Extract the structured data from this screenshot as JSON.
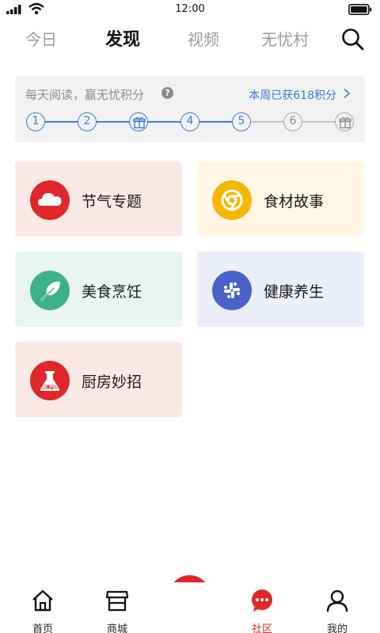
{
  "status_bar": {
    "time": "12:00"
  },
  "top_tabs": {
    "tabs": [
      {
        "label": "今日"
      },
      {
        "label": "发现"
      },
      {
        "label": "视频"
      },
      {
        "label": "无忧村"
      }
    ],
    "active_index": 1
  },
  "reading": {
    "title": "每天阅读，赢无忧积分",
    "help": "?",
    "week_points": "本周已获618积分",
    "steps": [
      "1",
      "2",
      "gift",
      "4",
      "5",
      "6",
      "gift"
    ],
    "completed_steps": 5
  },
  "categories": [
    {
      "label": "节气专题",
      "icon": "cloud-icon",
      "bg": "#fbe9e7",
      "icon_bg": "#e0282a"
    },
    {
      "label": "食材故事",
      "icon": "chrome-icon",
      "bg": "#fff6e4",
      "icon_bg": "#f5b800"
    },
    {
      "label": "美食烹饪",
      "icon": "feather-icon",
      "bg": "#e8f5f0",
      "icon_bg": "#3db389"
    },
    {
      "label": "健康养生",
      "icon": "slack-icon",
      "bg": "#eceefa",
      "icon_bg": "#4a63c8"
    },
    {
      "label": "厨房妙招",
      "icon": "flask-icon",
      "bg": "#fbe9e7",
      "icon_bg": "#e0282a"
    }
  ],
  "bottom_nav": {
    "items": [
      {
        "label": "首页",
        "icon": "home-icon"
      },
      {
        "label": "商城",
        "icon": "store-icon"
      },
      {
        "label": "社区",
        "icon": "chat-icon"
      },
      {
        "label": "我的",
        "icon": "user-icon"
      }
    ],
    "active_label": "社区",
    "center_icon": "scan-icon"
  },
  "colors": {
    "accent_red": "#e0282a",
    "accent_blue": "#3f79cf",
    "muted_gray": "#a9a9a9"
  }
}
